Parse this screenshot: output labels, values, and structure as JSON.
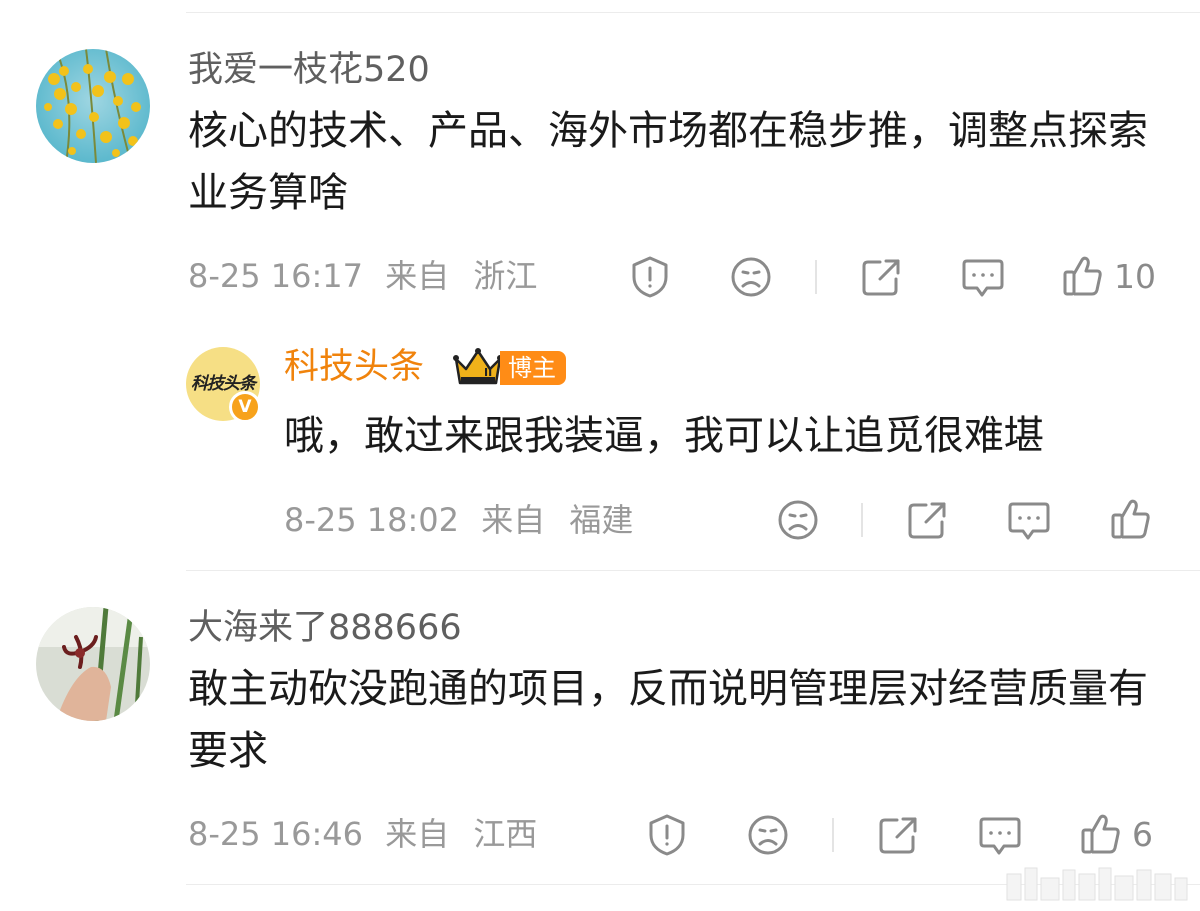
{
  "comments": [
    {
      "username": "我爱一枝花520",
      "text": "核心的技术、产品、海外市场都在稳步推，调整点探索业务算啥",
      "time": "8-25 16:17",
      "from": "来自",
      "region": "浙江",
      "like_count": "10",
      "icons": [
        "report-icon",
        "dislike-face-icon",
        "share-icon",
        "comment-icon",
        "like-thumb-icon"
      ]
    },
    {
      "username": "大海来了888666",
      "text": "敢主动砍没跑通的项目，反而说明管理层对经营质量有要求",
      "time": "8-25 16:46",
      "from": "来自",
      "region": "江西",
      "like_count": "6",
      "icons": [
        "report-icon",
        "dislike-face-icon",
        "share-icon",
        "comment-icon",
        "like-thumb-icon"
      ]
    }
  ],
  "reply": {
    "username": "科技头条",
    "avatar_text": "科技头条",
    "verified_mark": "V",
    "crown_level": "II",
    "badge": "博主",
    "text": "哦，敢过来跟我装逼，我可以让追觅很难堪",
    "time": "8-25 18:02",
    "from": "来自",
    "region": "福建",
    "icons": [
      "dislike-face-icon",
      "share-icon",
      "comment-icon",
      "like-thumb-icon"
    ]
  },
  "colors": {
    "accent_orange": "#f0830c",
    "badge_orange": "#ff8c16",
    "meta_gray": "#999999",
    "text_dark": "#1a1a1a"
  }
}
